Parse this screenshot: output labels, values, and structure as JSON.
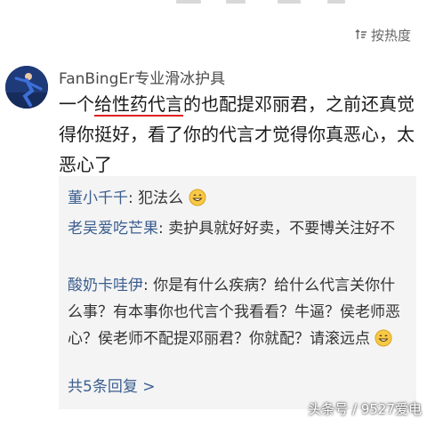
{
  "header": {
    "sort_label": "按热度",
    "sort_icon": "sort-icon"
  },
  "comment": {
    "username": "FanBingEr专业滑冰护具",
    "text_before": "一个",
    "text_underlined": "给性药代言",
    "text_after": "的也配提邓丽君，之前还真觉得你挺好，看了你的代言才觉得你真恶心，太恶心了"
  },
  "replies": [
    {
      "name": "董小千千",
      "sep": ": ",
      "text": "犯法么",
      "emoji": "grinning-emoji"
    },
    {
      "name": "老吴爱吃芒果",
      "sep": ": ",
      "text": "卖护具就好好卖，不要博关注好不"
    },
    {
      "name": "酸奶卡哇伊",
      "sep": ": ",
      "text": "你是有什么疾病？给什么代言关你什么事？有本事你也代言个我看看？牛逼？侯老师恶心？侯老师不配提邓丽君？你就配？请滚远点",
      "emoji": "grinning-emoji"
    }
  ],
  "more_replies_label": "共5条回复 >",
  "watermark": "头条号 / 9527爱电",
  "colors": {
    "link": "#3b5e8f",
    "underline": "#e02020",
    "reply_bg": "#f4f4f4"
  }
}
